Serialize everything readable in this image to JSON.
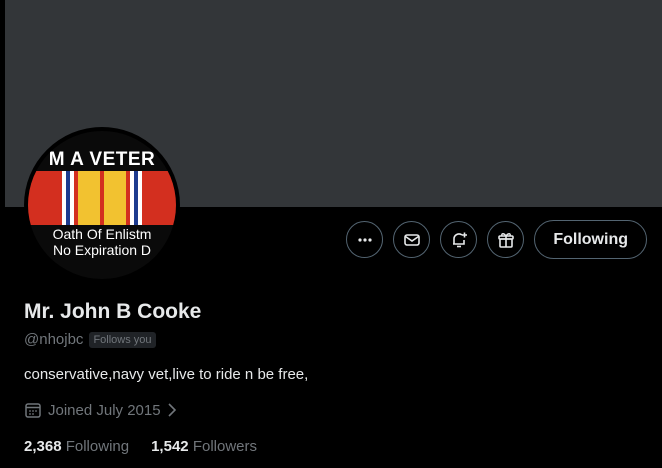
{
  "avatar": {
    "top_text": "M A VETER",
    "line1": "Oath Of Enlistm",
    "line2": "No Expiration D",
    "ribbon_colors": [
      "#d32f1f",
      "#f2c230",
      "#ffffff",
      "#1d3b8f"
    ]
  },
  "actions": {
    "more_icon": "more-icon",
    "message_icon": "envelope-icon",
    "notify_icon": "bell-plus-icon",
    "subscribe_icon": "gift-icon",
    "follow_label": "Following"
  },
  "profile": {
    "name": "Mr. John B Cooke",
    "handle": "@nhojbc",
    "follows_you": "Follows you",
    "bio": "conservative,navy vet,live to ride n be free,",
    "joined": "Joined July 2015",
    "following_count": "2,368",
    "following_label": "Following",
    "followers_count": "1,542",
    "followers_label": "Followers"
  },
  "colors": {
    "background": "#000000",
    "banner": "#333639",
    "text_primary": "#e7e9ea",
    "text_secondary": "#71767b",
    "border": "#536471"
  }
}
